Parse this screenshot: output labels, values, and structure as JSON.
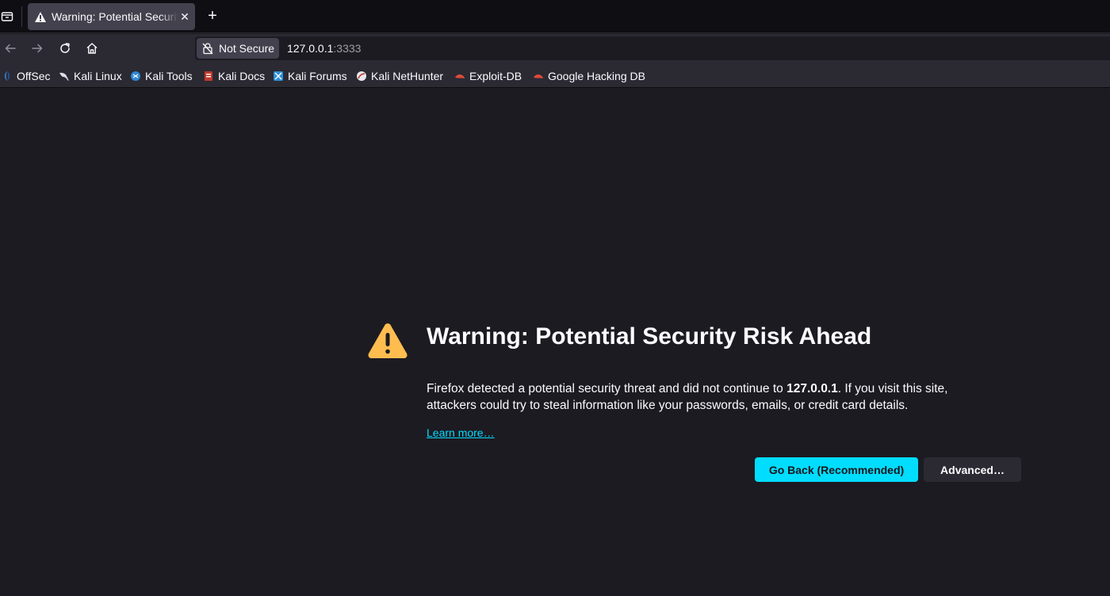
{
  "tab": {
    "title": "Warning: Potential Security Risk",
    "close_glyph": "✕",
    "new_tab_glyph": "+"
  },
  "urlbar": {
    "security_label": "Not Secure",
    "host": "127.0.0.1",
    "port": ":3333"
  },
  "bookmarks": [
    {
      "label": "OffSec",
      "icon": "offsec-icon"
    },
    {
      "label": "Kali Linux",
      "icon": "kali-dragon-icon"
    },
    {
      "label": "Kali Tools",
      "icon": "kali-tools-icon"
    },
    {
      "label": "Kali Docs",
      "icon": "kali-docs-icon"
    },
    {
      "label": "Kali Forums",
      "icon": "kali-forums-icon"
    },
    {
      "label": "Kali NetHunter",
      "icon": "kali-nethunter-icon"
    },
    {
      "label": "Exploit-DB",
      "icon": "exploit-db-icon"
    },
    {
      "label": "Google Hacking DB",
      "icon": "google-hacking-db-icon"
    }
  ],
  "page": {
    "title": "Warning: Potential Security Risk Ahead",
    "desc_before": "Firefox detected a potential security threat and did not continue to ",
    "desc_host": "127.0.0.1",
    "desc_after": ". If you visit this site, attackers could try to steal information like your passwords, emails, or credit card details.",
    "learn_more": "Learn more…",
    "go_back": "Go Back (Recommended)",
    "advanced": "Advanced…"
  },
  "colors": {
    "accent": "#00ddff",
    "warning": "#ffbd4f",
    "background": "#1c1b22"
  }
}
